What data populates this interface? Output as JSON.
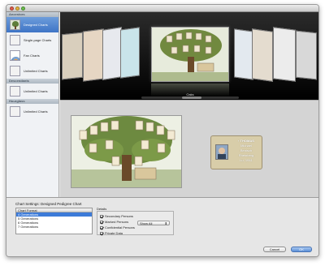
{
  "titlebar": {
    "close_color": "#e25c4b",
    "minimize_color": "#e6b33b",
    "zoom_color": "#6bbf4b"
  },
  "sidebar": {
    "sections": [
      {
        "header": "Ancestors",
        "items": [
          {
            "label": "Designed Charts",
            "selected": true,
            "icon": "tree-chart-thumbnail-icon"
          },
          {
            "label": "Single-page Charts",
            "selected": false,
            "icon": "tree-chart-thumbnail-icon"
          },
          {
            "label": "Fan Charts",
            "selected": false,
            "icon": "fan-chart-thumbnail-icon"
          },
          {
            "label": "Unlimited Charts",
            "selected": false,
            "icon": "tree-chart-thumbnail-icon"
          }
        ]
      },
      {
        "header": "Descendants",
        "items": [
          {
            "label": "Unlimited Charts",
            "selected": false,
            "icon": "tree-chart-thumbnail-icon"
          }
        ]
      },
      {
        "header": "Hourglass",
        "items": [
          {
            "label": "Unlimited Charts",
            "selected": false,
            "icon": "tree-chart-thumbnail-icon"
          }
        ]
      }
    ]
  },
  "carousel": {
    "caption": "Oaks"
  },
  "badge": {
    "name_line1": "‹ THOMAS",
    "name_line2": "Michael",
    "line3": "Benisch",
    "line4": "Rheinberg",
    "line5": "Lu, 1941"
  },
  "settings": {
    "title": "Chart Settings: Designed Pedigree Chart",
    "format_header": "Chart Format",
    "formats": [
      {
        "label": "4 Generations",
        "selected": true
      },
      {
        "label": "5 Generations",
        "selected": false
      },
      {
        "label": "6 Generations",
        "selected": false
      },
      {
        "label": "7 Generations",
        "selected": false
      }
    ],
    "details_label": "Details",
    "options": [
      {
        "label": "Secondary Persons",
        "checked": true
      },
      {
        "label": "Marked Persons",
        "checked": true
      },
      {
        "label": "Confidential Persons",
        "checked": true
      },
      {
        "label": "Private Data",
        "checked": true
      }
    ],
    "confidential_popup": "Show All",
    "cancel_label": "Cancel",
    "ok_label": "OK"
  },
  "colors": {
    "selection_blue": "#3e74c6",
    "carousel_bg": "#111111"
  }
}
